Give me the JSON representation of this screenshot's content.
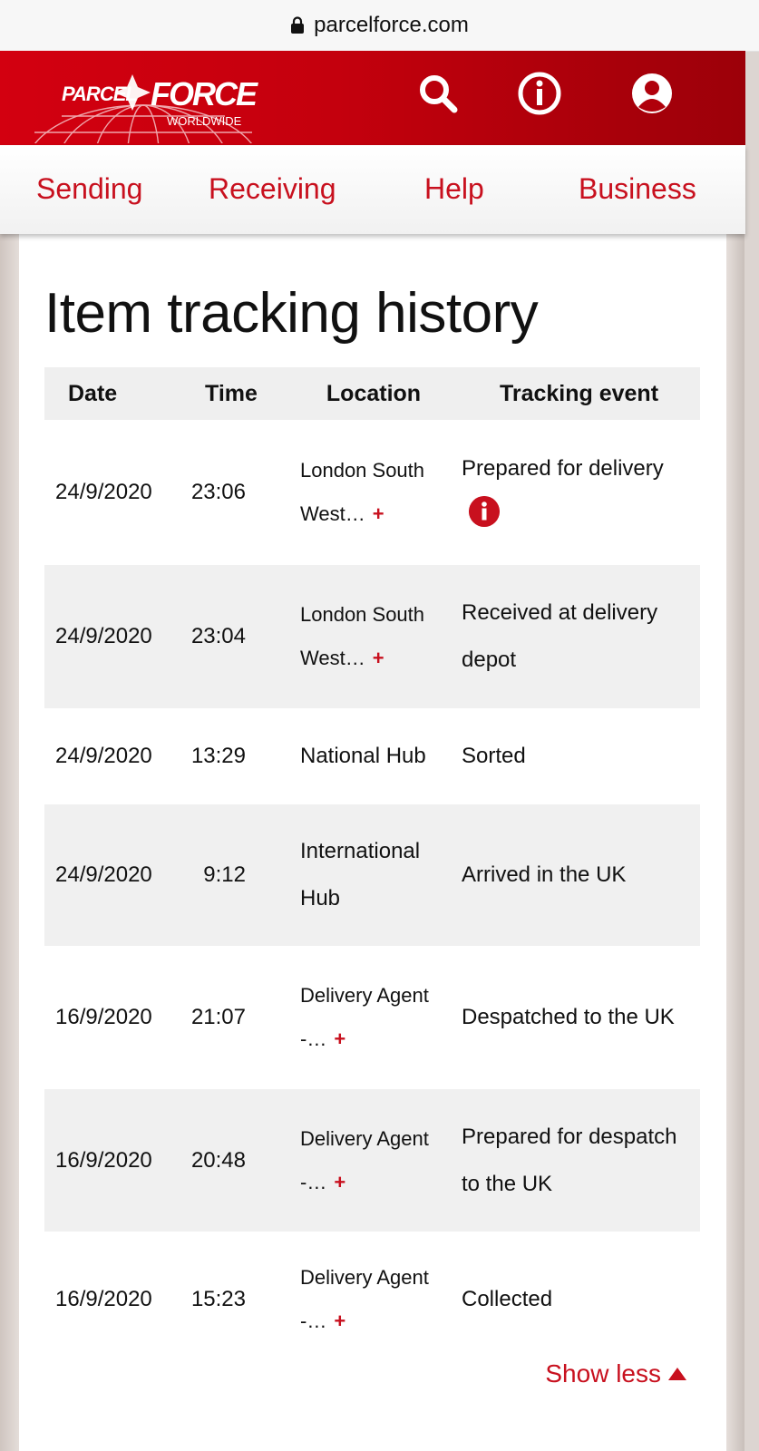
{
  "browser": {
    "url": "parcelforce.com"
  },
  "header": {
    "logo_top": "PARCEL",
    "logo_main": "FORCE",
    "logo_sub": "WORLDWIDE"
  },
  "nav": [
    "Sending",
    "Receiving",
    "Help",
    "Business"
  ],
  "page": {
    "title": "Item tracking history"
  },
  "table": {
    "headers": [
      "Date",
      "Time",
      "Location",
      "Tracking event"
    ],
    "rows": [
      {
        "date": "24/9/2020",
        "time": "23:06",
        "location": "London South West…",
        "location_expandable": true,
        "event": "Prepared for delivery",
        "event_info": true
      },
      {
        "date": "24/9/2020",
        "time": "23:04",
        "location": "London South West…",
        "location_expandable": true,
        "event": "Received at delivery depot"
      },
      {
        "date": "24/9/2020",
        "time": "13:29",
        "location": "National Hub",
        "event": "Sorted"
      },
      {
        "date": "24/9/2020",
        "time": "9:12",
        "location": "International Hub",
        "event": "Arrived in the UK"
      },
      {
        "date": "16/9/2020",
        "time": "21:07",
        "location": "Delivery Agent -…",
        "location_expandable": true,
        "event": "Despatched to the UK"
      },
      {
        "date": "16/9/2020",
        "time": "20:48",
        "location": "Delivery Agent -…",
        "location_expandable": true,
        "event": "Prepared for despatch to the UK"
      },
      {
        "date": "16/9/2020",
        "time": "15:23",
        "location": "Delivery Agent -…",
        "location_expandable": true,
        "event": "Collected"
      }
    ],
    "expand_symbol": "+"
  },
  "show_less": "Show less",
  "colors": {
    "brand_red": "#c8101e",
    "header_red": "#c4000d"
  },
  "icons": [
    "lock-icon",
    "search-icon",
    "info-icon",
    "account-icon",
    "chevron-up-icon"
  ]
}
